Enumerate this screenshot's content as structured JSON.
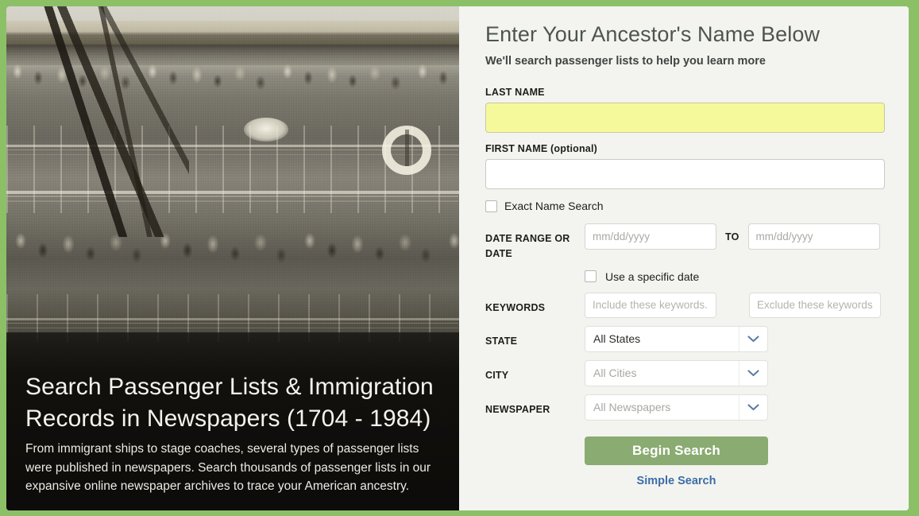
{
  "theme": {
    "page_border_green": "#8cc067",
    "panel_background": "#f3f4ef",
    "highlight_field_yellow": "#f6f99b",
    "primary_button_green": "#8aab71",
    "link_blue": "#3c6ca8",
    "dropdown_arrow_blue": "#5b7ca8"
  },
  "hero": {
    "title": "Search Passenger Lists & Immigration Records in Newspapers (1704 - 1984)",
    "description": "From immigrant ships to stage coaches, several types of passenger lists were published in newspapers. Search thousands of passenger lists in our expansive online newspaper archives to trace your American ancestry.",
    "image_alt": "historic-sepia-photo-passengers-on-ship-deck"
  },
  "form": {
    "heading": "Enter Your Ancestor's Name Below",
    "subheading": "We'll search passenger lists to help you learn more",
    "last_name": {
      "label": "LAST NAME",
      "value": "",
      "placeholder": ""
    },
    "first_name": {
      "label": "FIRST NAME (optional)",
      "value": "",
      "placeholder": ""
    },
    "exact_name_search": {
      "label": "Exact Name Search",
      "checked": false
    },
    "date_range": {
      "label": "DATE RANGE OR DATE",
      "from_placeholder": "mm/dd/yyyy",
      "from_value": "",
      "to_label": "TO",
      "to_placeholder": "mm/dd/yyyy",
      "to_value": ""
    },
    "use_specific_date": {
      "label": "Use a specific date",
      "checked": false
    },
    "keywords": {
      "label": "KEYWORDS",
      "include_placeholder": "Include these keywords..",
      "include_value": "",
      "exclude_placeholder": "Exclude these keywords.",
      "exclude_value": ""
    },
    "state": {
      "label": "STATE",
      "selected": "All States",
      "is_placeholder": false
    },
    "city": {
      "label": "CITY",
      "selected": "All Cities",
      "is_placeholder": true
    },
    "newspaper": {
      "label": "NEWSPAPER",
      "selected": "All Newspapers",
      "is_placeholder": true
    },
    "submit_label": "Begin Search",
    "simple_search_label": "Simple Search"
  }
}
